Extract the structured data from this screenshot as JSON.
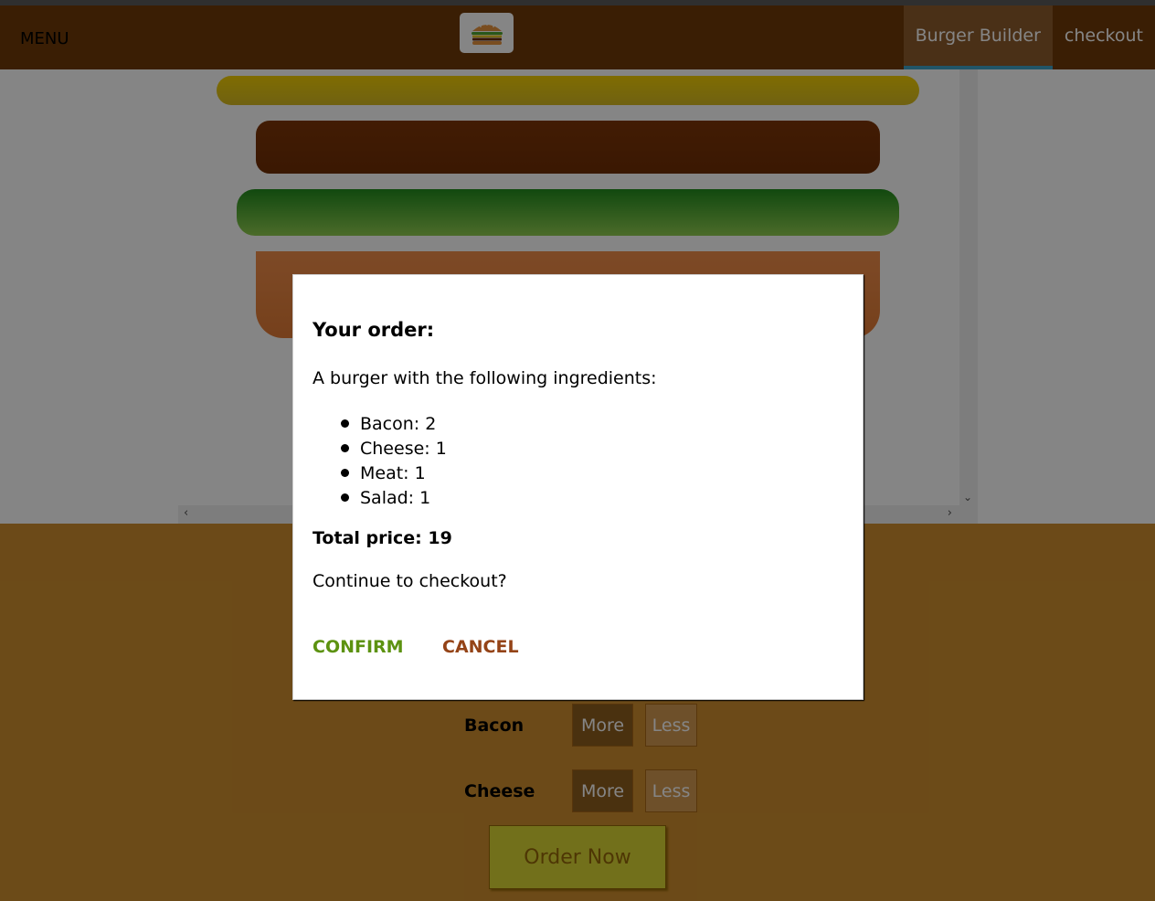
{
  "toolbar": {
    "menu_label": "MENU",
    "nav": [
      {
        "label": "Burger Builder",
        "active": true
      },
      {
        "label": "checkout",
        "active": false
      }
    ]
  },
  "build_controls": [
    {
      "label": "Bacon",
      "more": "More",
      "less": "Less"
    },
    {
      "label": "Cheese",
      "more": "More",
      "less": "Less"
    }
  ],
  "order_button": "Order Now",
  "modal": {
    "title": "Your order:",
    "intro": "A burger with the following ingredients:",
    "ingredients": [
      "Bacon: 2",
      "Cheese: 1",
      "Meat: 1",
      "Salad: 1"
    ],
    "total": "Total price: 19",
    "question": "Continue to checkout?",
    "confirm": "CONFIRM",
    "cancel": "CANCEL"
  },
  "colors": {
    "toolbar": "#703B09",
    "controls_bg": "#CF8F2E",
    "confirm": "#5C9210",
    "cancel": "#944317",
    "active_nav_underline": "#40A4C8"
  },
  "icons": {
    "logo": "burger-logo-icon",
    "scroll_down": "chevron-down-icon",
    "scroll_left": "chevron-left-icon",
    "scroll_right": "chevron-right-icon"
  }
}
